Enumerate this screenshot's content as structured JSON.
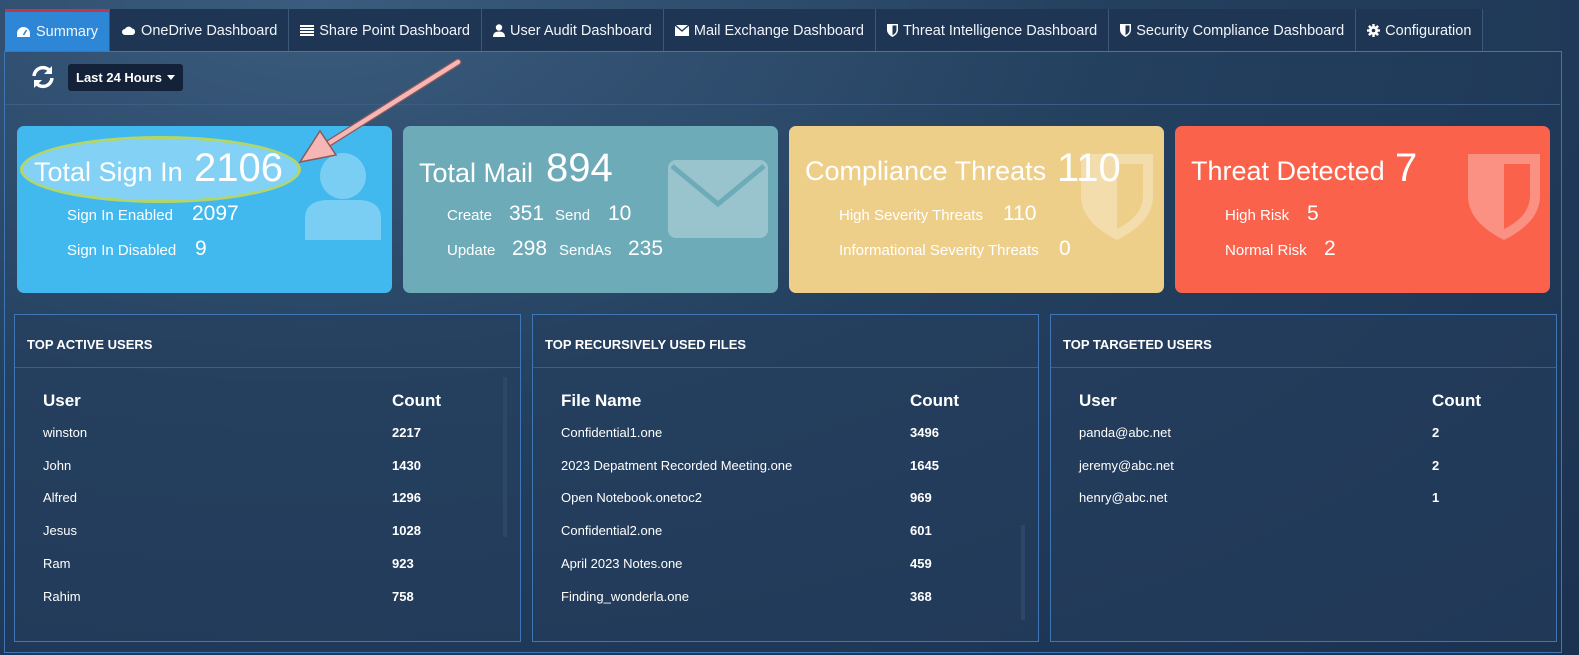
{
  "nav": {
    "tabs": [
      {
        "label": "Summary",
        "icon": "dashboard-icon",
        "active": true
      },
      {
        "label": "OneDrive Dashboard",
        "icon": "cloud-icon"
      },
      {
        "label": "Share Point Dashboard",
        "icon": "list-icon"
      },
      {
        "label": "User Audit Dashboard",
        "icon": "user-icon"
      },
      {
        "label": "Mail Exchange Dashboard",
        "icon": "envelope-icon"
      },
      {
        "label": "Threat Intelligence Dashboard",
        "icon": "shield-icon"
      },
      {
        "label": "Security Compliance Dashboard",
        "icon": "shield-icon"
      },
      {
        "label": "Configuration",
        "icon": "gear-icon"
      }
    ]
  },
  "toolbar": {
    "refresh_icon": "refresh-icon",
    "range_label": "Last 24 Hours"
  },
  "cards": {
    "signin": {
      "title": "Total Sign In",
      "value": "2106",
      "enabled_label": "Sign In Enabled",
      "enabled_value": "2097",
      "disabled_label": "Sign In Disabled",
      "disabled_value": "9",
      "icon": "user-icon",
      "color": "#41b9ee"
    },
    "mail": {
      "title": "Total Mail",
      "value": "894",
      "create_label": "Create",
      "create_value": "351",
      "send_label": "Send",
      "send_value": "10",
      "update_label": "Update",
      "update_value": "298",
      "sendas_label": "SendAs",
      "sendas_value": "235",
      "icon": "envelope-icon",
      "color": "#6eabb8"
    },
    "compliance": {
      "title": "Compliance Threats",
      "value": "110",
      "high_label": "High Severity Threats",
      "high_value": "110",
      "info_label": "Informational Severity Threats",
      "info_value": "0",
      "icon": "shield-icon",
      "color": "#eecf8a"
    },
    "threat": {
      "title": "Threat Detected",
      "value": "7",
      "high_label": "High Risk",
      "high_value": "5",
      "normal_label": "Normal Risk",
      "normal_value": "2",
      "icon": "shield-icon",
      "color": "#fa624c"
    }
  },
  "tables": {
    "active_users": {
      "title": "TOP ACTIVE USERS",
      "col1": "User",
      "col2": "Count",
      "rows": [
        [
          "winston",
          "2217"
        ],
        [
          "John",
          "1430"
        ],
        [
          "Alfred",
          "1296"
        ],
        [
          "Jesus",
          "1028"
        ],
        [
          "Ram",
          "923"
        ],
        [
          "Rahim",
          "758"
        ]
      ]
    },
    "files": {
      "title": "TOP RECURSIVELY USED FILES",
      "col1": "File Name",
      "col2": "Count",
      "rows": [
        [
          "Confidential1.one",
          "3496"
        ],
        [
          "2023 Depatment Recorded Meeting.one",
          "1645"
        ],
        [
          "Open Notebook.onetoc2",
          "969"
        ],
        [
          "Confidential2.one",
          "601"
        ],
        [
          "April 2023 Notes.one",
          "459"
        ],
        [
          "Finding_wonderla.one",
          "368"
        ]
      ]
    },
    "targeted_users": {
      "title": "TOP TARGETED USERS",
      "col1": "User",
      "col2": "Count",
      "rows": [
        [
          "panda@abc.net",
          "2"
        ],
        [
          "jeremy@abc.net",
          "2"
        ],
        [
          "henry@abc.net",
          "1"
        ]
      ]
    }
  }
}
